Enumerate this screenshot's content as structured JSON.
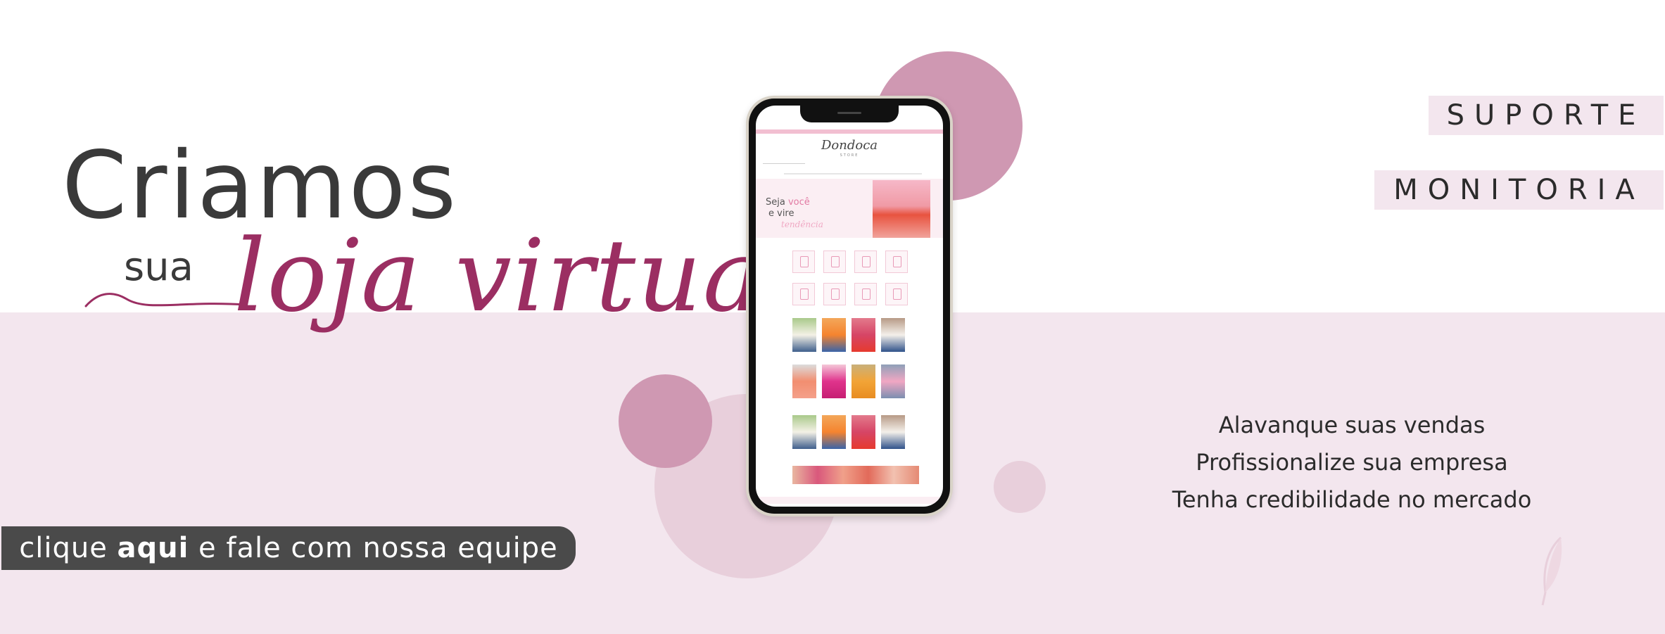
{
  "headline": {
    "line1": "Criamos",
    "line2": "sua",
    "line3": "loja virtual"
  },
  "cta": {
    "prefix": "clique ",
    "bold": "aqui",
    "suffix": " e fale com nossa equipe"
  },
  "tags": {
    "suporte": "SUPORTE",
    "monitoria": "MONITORIA"
  },
  "benefits": [
    "Alavanque suas vendas",
    "Profissionalize sua empresa",
    "Tenha credibilidade no mercado"
  ],
  "phone_screen": {
    "logo": "Dondoca",
    "logo_sub": "STORE",
    "hero_line1_a": "Seja ",
    "hero_line1_b": "você",
    "hero_line2": "e vire",
    "hero_line3": "tendência"
  },
  "colors": {
    "accent": "#9b2e62",
    "band": "#f3e6ee",
    "circle_dark": "#cf98b2",
    "circle_light": "#e8cfdb",
    "cta_bg": "#4a4a4a",
    "text_dark": "#3a3a3a"
  },
  "icons": {
    "logo_mark": "feather-icon"
  }
}
